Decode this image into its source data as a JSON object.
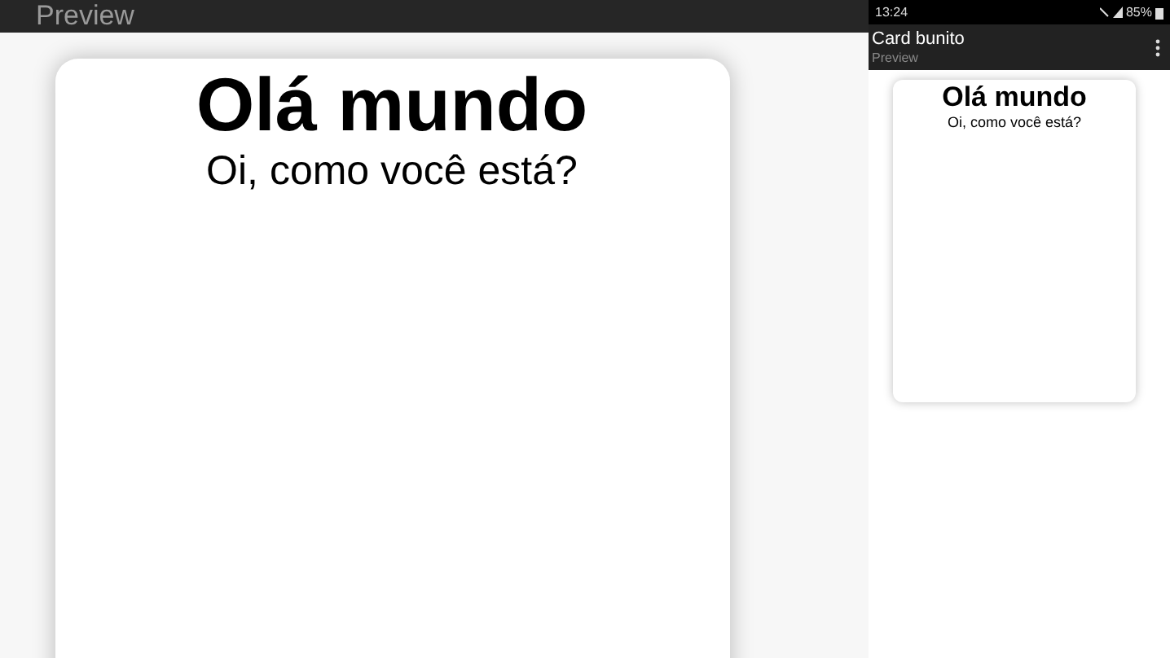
{
  "main": {
    "header_title": "Preview",
    "card": {
      "title": "Olá mundo",
      "subtitle": "Oi, como você está?"
    }
  },
  "phone": {
    "status_bar": {
      "time": "13:24",
      "battery": "85%"
    },
    "app_bar": {
      "title": "Card bunito",
      "subtitle": "Preview"
    },
    "card": {
      "title": "Olá mundo",
      "subtitle": "Oi, como você está?"
    }
  }
}
